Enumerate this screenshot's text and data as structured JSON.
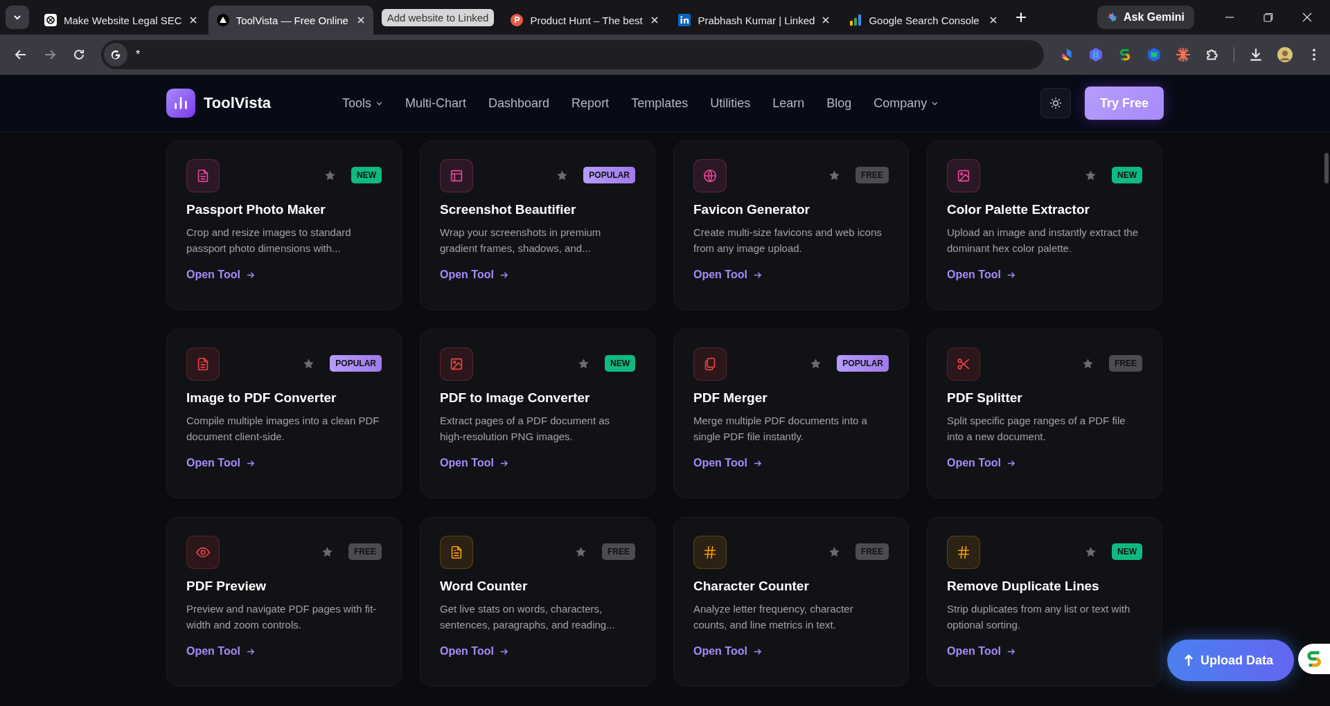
{
  "browser": {
    "tabs": [
      {
        "kind": "chat",
        "label": "Make Website Legal SEC",
        "selected": false
      },
      {
        "kind": "triangle",
        "label": "ToolVista — Free Online",
        "selected": true
      },
      {
        "kind": "group",
        "label": "Add website to Linked",
        "selected": false
      },
      {
        "kind": "p-circle",
        "label": "Product Hunt – The best",
        "selected": false
      },
      {
        "kind": "in",
        "label": "Prabhash Kumar | Linked",
        "selected": false
      },
      {
        "kind": "bars",
        "label": "Google Search Console",
        "selected": false
      }
    ],
    "ask_button": "Ask Gemini",
    "address": "*"
  },
  "site": {
    "logo": "ToolVista",
    "nav": [
      {
        "label": "Tools",
        "dropdown": true
      },
      {
        "label": "Multi-Chart",
        "dropdown": false
      },
      {
        "label": "Dashboard",
        "dropdown": false
      },
      {
        "label": "Report",
        "dropdown": false
      },
      {
        "label": "Templates",
        "dropdown": false
      },
      {
        "label": "Utilities",
        "dropdown": false
      },
      {
        "label": "Learn",
        "dropdown": false
      },
      {
        "label": "Blog",
        "dropdown": false
      },
      {
        "label": "Company",
        "dropdown": true
      }
    ],
    "cta": "Try Free"
  },
  "tools": [
    {
      "kind": "document",
      "color": "#ec4899",
      "badge": {
        "kind": "new",
        "label": "NEW"
      },
      "title": "Passport Photo Maker",
      "description": "Crop and resize images to standard passport photo dimensions with...",
      "link": "Open Tool"
    },
    {
      "kind": "layout",
      "color": "#ec4899",
      "badge": {
        "kind": "popular",
        "label": "POPULAR"
      },
      "title": "Screenshot Beautifier",
      "description": "Wrap your screenshots in premium gradient frames, shadows, and...",
      "link": "Open Tool"
    },
    {
      "kind": "globe",
      "color": "#ec4899",
      "badge": {
        "kind": "free",
        "label": "FREE"
      },
      "title": "Favicon Generator",
      "description": "Create multi-size favicons and web icons from any image upload.",
      "link": "Open Tool"
    },
    {
      "kind": "image",
      "color": "#ec4899",
      "badge": {
        "kind": "new",
        "label": "NEW"
      },
      "title": "Color Palette Extractor",
      "description": "Upload an image and instantly extract the dominant hex color palette.",
      "link": "Open Tool"
    },
    {
      "kind": "document",
      "color": "#ef4444",
      "badge": {
        "kind": "popular",
        "label": "POPULAR"
      },
      "title": "Image to PDF Converter",
      "description": "Compile multiple images into a clean PDF document client-side.",
      "link": "Open Tool"
    },
    {
      "kind": "image",
      "color": "#ef4444",
      "badge": {
        "kind": "new",
        "label": "NEW"
      },
      "title": "PDF to Image Converter",
      "description": "Extract pages of a PDF document as high-resolution PNG images.",
      "link": "Open Tool"
    },
    {
      "kind": "files",
      "color": "#ef4444",
      "badge": {
        "kind": "popular",
        "label": "POPULAR"
      },
      "title": "PDF Merger",
      "description": "Merge multiple PDF documents into a single PDF file instantly.",
      "link": "Open Tool"
    },
    {
      "kind": "scissors",
      "color": "#ef4444",
      "badge": {
        "kind": "free",
        "label": "FREE"
      },
      "title": "PDF Splitter",
      "description": "Split specific page ranges of a PDF file into a new document.",
      "link": "Open Tool"
    },
    {
      "kind": "eye",
      "color": "#ef4444",
      "badge": {
        "kind": "free",
        "label": "FREE"
      },
      "title": "PDF Preview",
      "description": "Preview and navigate PDF pages with fit-width and zoom controls.",
      "link": "Open Tool"
    },
    {
      "kind": "document",
      "color": "#f59e0b",
      "badge": {
        "kind": "free",
        "label": "FREE"
      },
      "title": "Word Counter",
      "description": "Get live stats on words, characters, sentences, paragraphs, and reading...",
      "link": "Open Tool"
    },
    {
      "kind": "hash",
      "color": "#f59e0b",
      "badge": {
        "kind": "free",
        "label": "FREE"
      },
      "title": "Character Counter",
      "description": "Analyze letter frequency, character counts, and line metrics in text.",
      "link": "Open Tool"
    },
    {
      "kind": "hash",
      "color": "#f59e0b",
      "badge": {
        "kind": "new",
        "label": "NEW"
      },
      "title": "Remove Duplicate Lines",
      "description": "Strip duplicates from any list or text with optional sorting.",
      "link": "Open Tool"
    }
  ],
  "upload_button": "Upload Data"
}
